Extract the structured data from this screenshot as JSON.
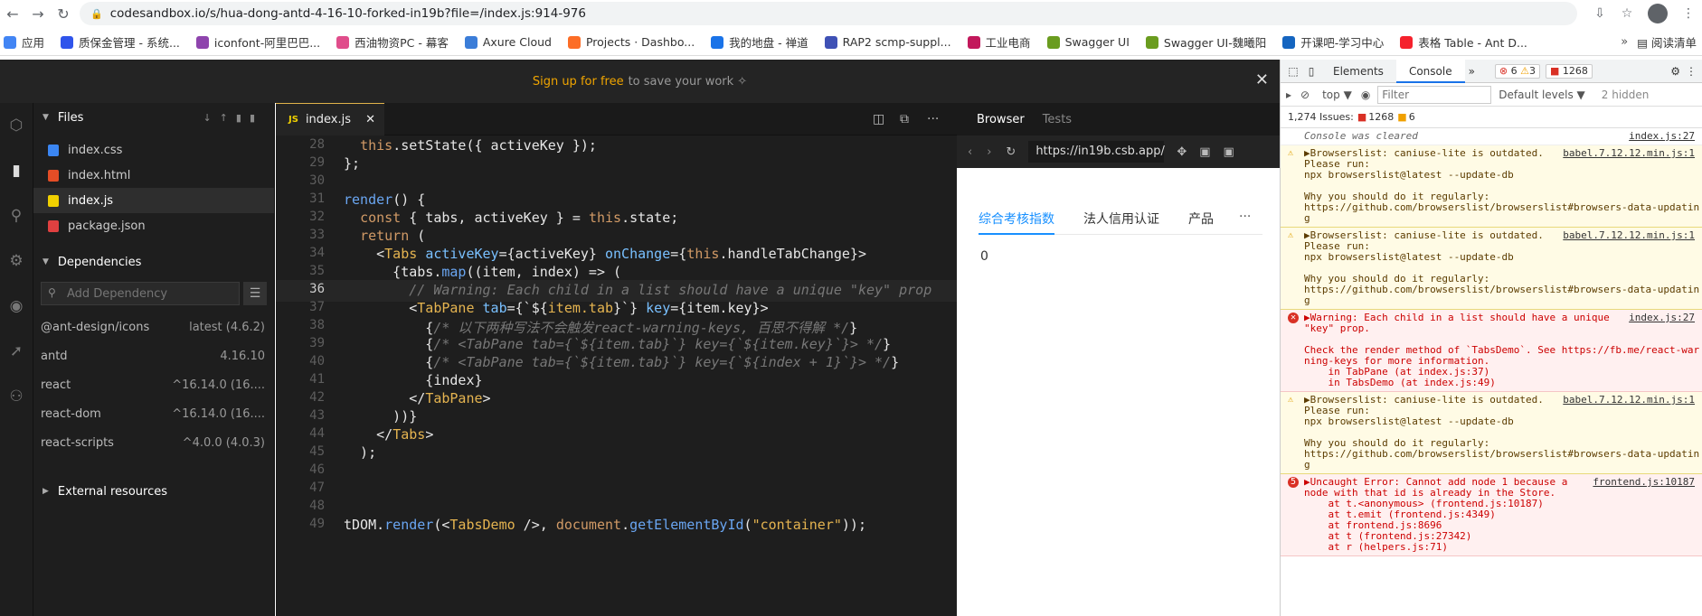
{
  "browser": {
    "url": "codesandbox.io/s/hua-dong-antd-4-16-10-forked-in19b?file=/index.js:914-976"
  },
  "bookmarks": [
    {
      "label": "应用",
      "color": "#4285f4"
    },
    {
      "label": "质保金管理 - 系统...",
      "color": "#2f54eb"
    },
    {
      "label": "iconfont-阿里巴巴...",
      "color": "#8e44ad"
    },
    {
      "label": "西油物资PC - 幕客",
      "color": "#e04d8b"
    },
    {
      "label": "Axure Cloud",
      "color": "#3b7dd8"
    },
    {
      "label": "Projects · Dashbo...",
      "color": "#fc6d26"
    },
    {
      "label": "我的地盘 - 禅道",
      "color": "#1a73e8"
    },
    {
      "label": "RAP2 scmp-suppl...",
      "color": "#3f51b5"
    },
    {
      "label": "工业电商",
      "color": "#c2185b"
    },
    {
      "label": "Swagger UI",
      "color": "#6a9c1f"
    },
    {
      "label": "Swagger UI-魏曦阳",
      "color": "#6a9c1f"
    },
    {
      "label": "开课吧-学习中心",
      "color": "#1565c0"
    },
    {
      "label": "表格 Table - Ant D...",
      "color": "#f5222d"
    }
  ],
  "bookmarks_more": "»",
  "reading_list": "阅读清单",
  "signup": {
    "link": "Sign up for free",
    "rest": "to save your work ✧"
  },
  "sidebar": {
    "files_title": "Files",
    "files": [
      {
        "name": "index.css",
        "ico": "#3b86f2"
      },
      {
        "name": "index.html",
        "ico": "#e44d26"
      },
      {
        "name": "index.js",
        "ico": "#f0d000",
        "active": true
      },
      {
        "name": "package.json",
        "ico": "#e04040"
      }
    ],
    "deps_title": "Dependencies",
    "add_dep_placeholder": "Add Dependency",
    "deps": [
      {
        "name": "@ant-design/icons",
        "ver": "latest (4.6.2)"
      },
      {
        "name": "antd",
        "ver": "4.16.10"
      },
      {
        "name": "react",
        "ver": "^16.14.0 (16...."
      },
      {
        "name": "react-dom",
        "ver": "^16.14.0 (16...."
      },
      {
        "name": "react-scripts",
        "ver": "^4.0.0 (4.0.3)"
      }
    ],
    "ext_title": "External resources"
  },
  "editor": {
    "tab": "index.js",
    "lines": [
      {
        "n": "28",
        "html": "  <span class='kw'>this</span>.setState({ activeKey });"
      },
      {
        "n": "29",
        "html": "};"
      },
      {
        "n": "30",
        "html": ""
      },
      {
        "n": "31",
        "html": "<span class='k'>render</span>() {"
      },
      {
        "n": "32",
        "html": "  <span class='kw'>const</span> { tabs, activeKey } = <span class='kw'>this</span>.state;"
      },
      {
        "n": "33",
        "html": "  <span class='kw'>return</span> ("
      },
      {
        "n": "34",
        "html": "    &lt;<span class='t'>Tabs</span> <span class='v'>activeKey</span>={activeKey} <span class='v'>onChange</span>={<span class='kw'>this</span>.handleTabChange}&gt;"
      },
      {
        "n": "35",
        "html": "      {tabs.<span class='k'>map</span>((item, index) =&gt; ("
      },
      {
        "n": "36",
        "html": "        <span class='cm'>// Warning: Each child in a list should have a unique \"key\" prop</span>"
      },
      {
        "n": "37",
        "html": "        &lt;<span class='t'>TabPane</span> <span class='v'>tab</span>={`${<span class='s'>item.tab</span>}`} <span class='v'>key</span>={item.key}&gt;"
      },
      {
        "n": "38",
        "html": "          {<span class='cm'>/* 以下两种写法不会触发react-warning-keys, 百思不得解 */</span>}"
      },
      {
        "n": "39",
        "html": "          {<span class='cm'>/* &lt;TabPane tab={`${item.tab}`} key={`${item.key}`}&gt; */</span>}"
      },
      {
        "n": "40",
        "html": "          {<span class='cm'>/* &lt;TabPane tab={`${item.tab}`} key={`${index + 1}`}&gt; */</span>}"
      },
      {
        "n": "41",
        "html": "          {index}"
      },
      {
        "n": "42",
        "html": "        &lt;/<span class='t'>TabPane</span>&gt;"
      },
      {
        "n": "43",
        "html": "      ))}"
      },
      {
        "n": "44",
        "html": "    &lt;/<span class='t'>Tabs</span>&gt;"
      },
      {
        "n": "45",
        "html": "  );"
      },
      {
        "n": "46",
        "html": ""
      },
      {
        "n": "47",
        "html": ""
      },
      {
        "n": "48",
        "html": ""
      },
      {
        "n": "49",
        "html": "tDOM.<span class='k'>render</span>(&lt;<span class='t'>TabsDemo</span> /&gt;, <span class='kw'>document</span>.<span class='k'>getElementById</span>(<span class='s'>\"container\"</span>));"
      }
    ]
  },
  "preview": {
    "tab_browser": "Browser",
    "tab_tests": "Tests",
    "url": "https://in19b.csb.app/",
    "tabs": [
      "综合考核指数",
      "法人信用认证",
      "产品"
    ],
    "more": "···",
    "content": "0"
  },
  "devtools": {
    "tabs": [
      "Elements",
      "Console"
    ],
    "errors": "6",
    "warnings": "3",
    "issues_badge": "1268",
    "context": "top ▼",
    "filter_placeholder": "Filter",
    "levels": "Default levels ▼",
    "hidden": "2 hidden",
    "issues_text": "1,274 Issues:",
    "issues_err": "1268",
    "issues_warn": "6",
    "messages": [
      {
        "type": "info",
        "icon": "",
        "text": "Console was cleared",
        "src": "index.js:27"
      },
      {
        "type": "warn",
        "icon": "⚠",
        "text": "▶Browserslist: caniuse-lite is outdated.\nPlease run:\nnpx browserslist@latest --update-db\n\nWhy you should do it regularly:\nhttps://github.com/browserslist/browserslist#browsers-data-updatin\ng",
        "src": "babel.7.12.12.min.js:1"
      },
      {
        "type": "warn",
        "icon": "⚠",
        "text": "▶Browserslist: caniuse-lite is outdated.\nPlease run:\nnpx browserslist@latest --update-db\n\nWhy you should do it regularly:\nhttps://github.com/browserslist/browserslist#browsers-data-updatin\ng",
        "src": "babel.7.12.12.min.js:1"
      },
      {
        "type": "err",
        "icon": "⊗",
        "text": "▶Warning: Each child in a list should have a unique\n\"key\" prop.\n\nCheck the render method of `TabsDemo`. See https://fb.me/react-war\nning-keys for more information.\n    in TabPane (at index.js:37)\n    in TabsDemo (at index.js:49)",
        "src": "index.js:27"
      },
      {
        "type": "warn",
        "icon": "⚠",
        "text": "▶Browserslist: caniuse-lite is outdated.\nPlease run:\nnpx browserslist@latest --update-db\n\nWhy you should do it regularly:\nhttps://github.com/browserslist/browserslist#browsers-data-updatin\ng",
        "src": "babel.7.12.12.min.js:1"
      },
      {
        "type": "err",
        "icon": "5",
        "text": "▶Uncaught Error: Cannot add node 1 because a\nnode with that id is already in the Store.\n    at t.<anonymous> (frontend.js:10187)\n    at t.emit (frontend.js:4349)\n    at frontend.js:8696\n    at t (frontend.js:27342)\n    at r (helpers.js:71)",
        "src": "frontend.js:10187"
      }
    ]
  }
}
